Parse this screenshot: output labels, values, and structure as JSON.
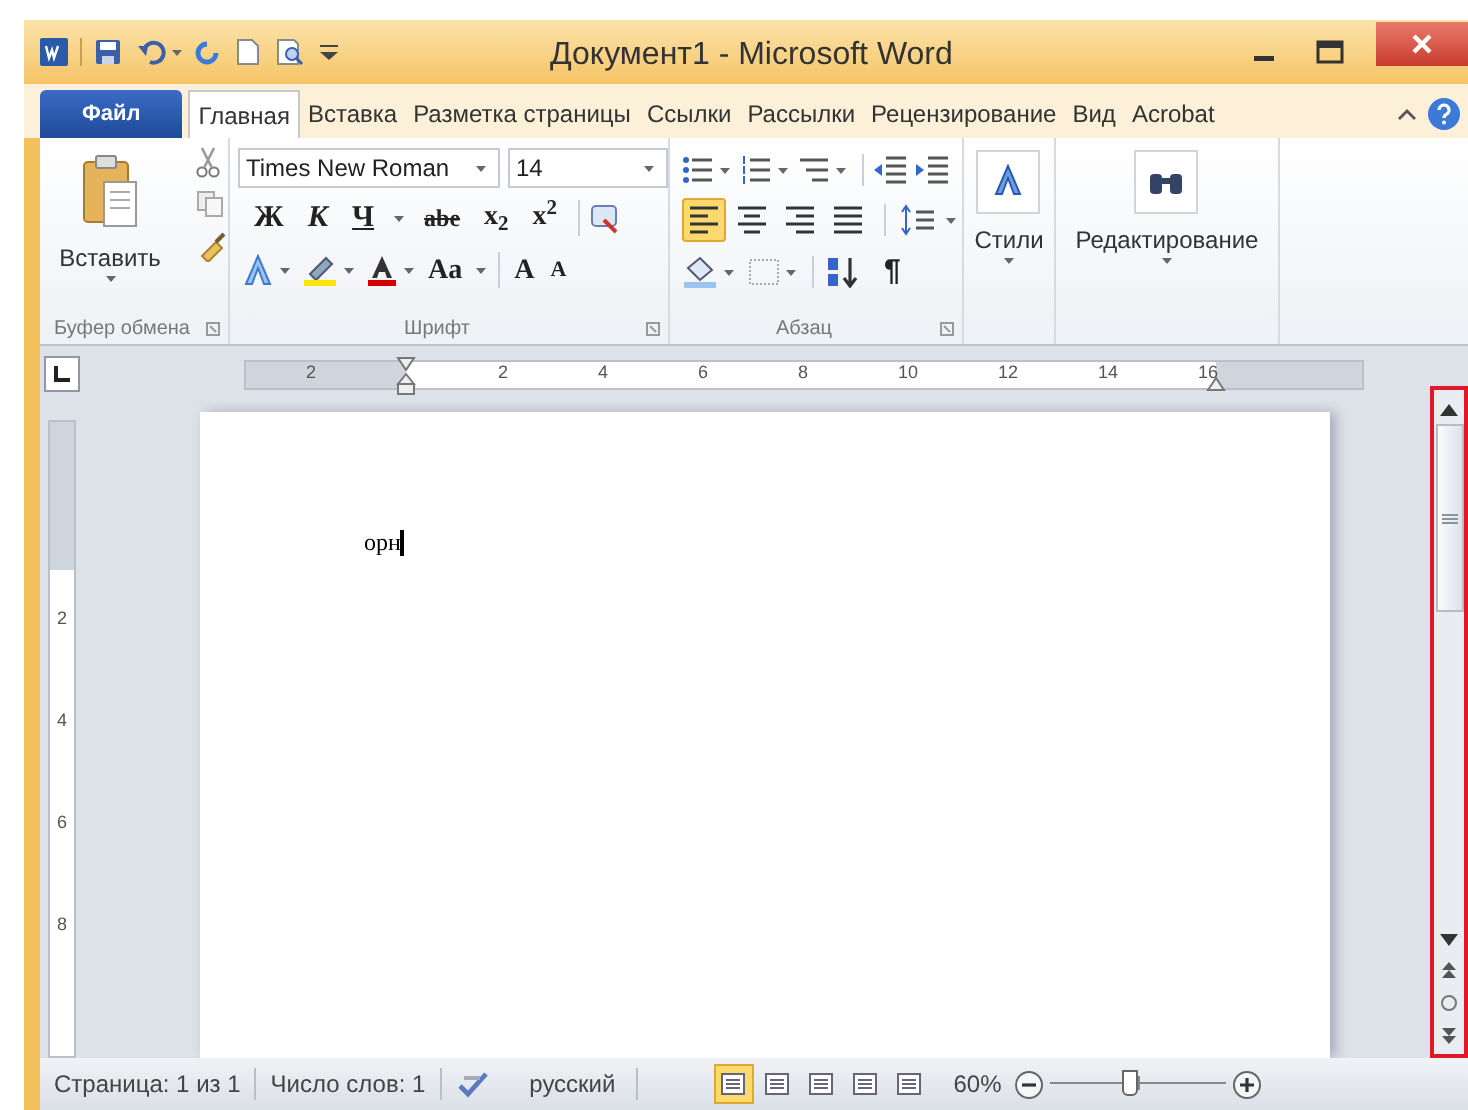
{
  "window": {
    "title": "Документ1 - Microsoft Word"
  },
  "tabs": [
    {
      "label": "Файл",
      "kind": "file",
      "selected": false
    },
    {
      "label": "Главная",
      "kind": "tab",
      "selected": true
    },
    {
      "label": "Вставка",
      "kind": "tab",
      "selected": false
    },
    {
      "label": "Разметка страницы",
      "kind": "tab",
      "selected": false
    },
    {
      "label": "Ссылки",
      "kind": "tab",
      "selected": false
    },
    {
      "label": "Рассылки",
      "kind": "tab",
      "selected": false
    },
    {
      "label": "Рецензирование",
      "kind": "tab",
      "selected": false
    },
    {
      "label": "Вид",
      "kind": "tab",
      "selected": false
    },
    {
      "label": "Acrobat",
      "kind": "tab",
      "selected": false
    }
  ],
  "ribbon": {
    "clipboard": {
      "paste": "Вставить",
      "label": "Буфер обмена"
    },
    "font": {
      "font_name": "Times New Roman",
      "font_size": "14",
      "format_buttons": [
        {
          "text": "Ж",
          "kind": "bold"
        },
        {
          "text": "К",
          "kind": "italic"
        },
        {
          "text": "Ч",
          "kind": "underline"
        },
        {
          "text": "abe",
          "kind": "strike"
        },
        {
          "text": "x$_{2}$",
          "kind": "sub"
        },
        {
          "text": "x$^{2}$",
          "kind": "sup"
        }
      ],
      "size_buttons": [
        "Aa",
        "A",
        "A"
      ],
      "label": "Шрифт"
    },
    "paragraph": {
      "alignments": [
        {
          "kind": "left",
          "selected": true
        },
        {
          "kind": "center",
          "selected": false
        },
        {
          "kind": "right",
          "selected": false
        },
        {
          "kind": "justify",
          "selected": false
        }
      ],
      "pilcrow": "¶",
      "label": "Абзац"
    },
    "styles": {
      "label": "Стили"
    },
    "editing": {
      "label": "Редактирование"
    }
  },
  "ruler": {
    "labels": [
      "2",
      "2",
      "4",
      "6",
      "8",
      "10",
      "12",
      "14",
      "16"
    ]
  },
  "vertical_ruler": {
    "labels": [
      "2",
      "4",
      "6",
      "8"
    ]
  },
  "document": {
    "text": "орн"
  },
  "status_bar": {
    "page": "Страница: 1 из 1",
    "words": "Число слов: 1",
    "language": "русский",
    "views": [
      {
        "selected": true
      },
      {
        "selected": false
      },
      {
        "selected": false
      },
      {
        "selected": false
      },
      {
        "selected": false
      }
    ],
    "zoom": "60%",
    "zoom_slider": {
      "level": 0.5
    }
  }
}
